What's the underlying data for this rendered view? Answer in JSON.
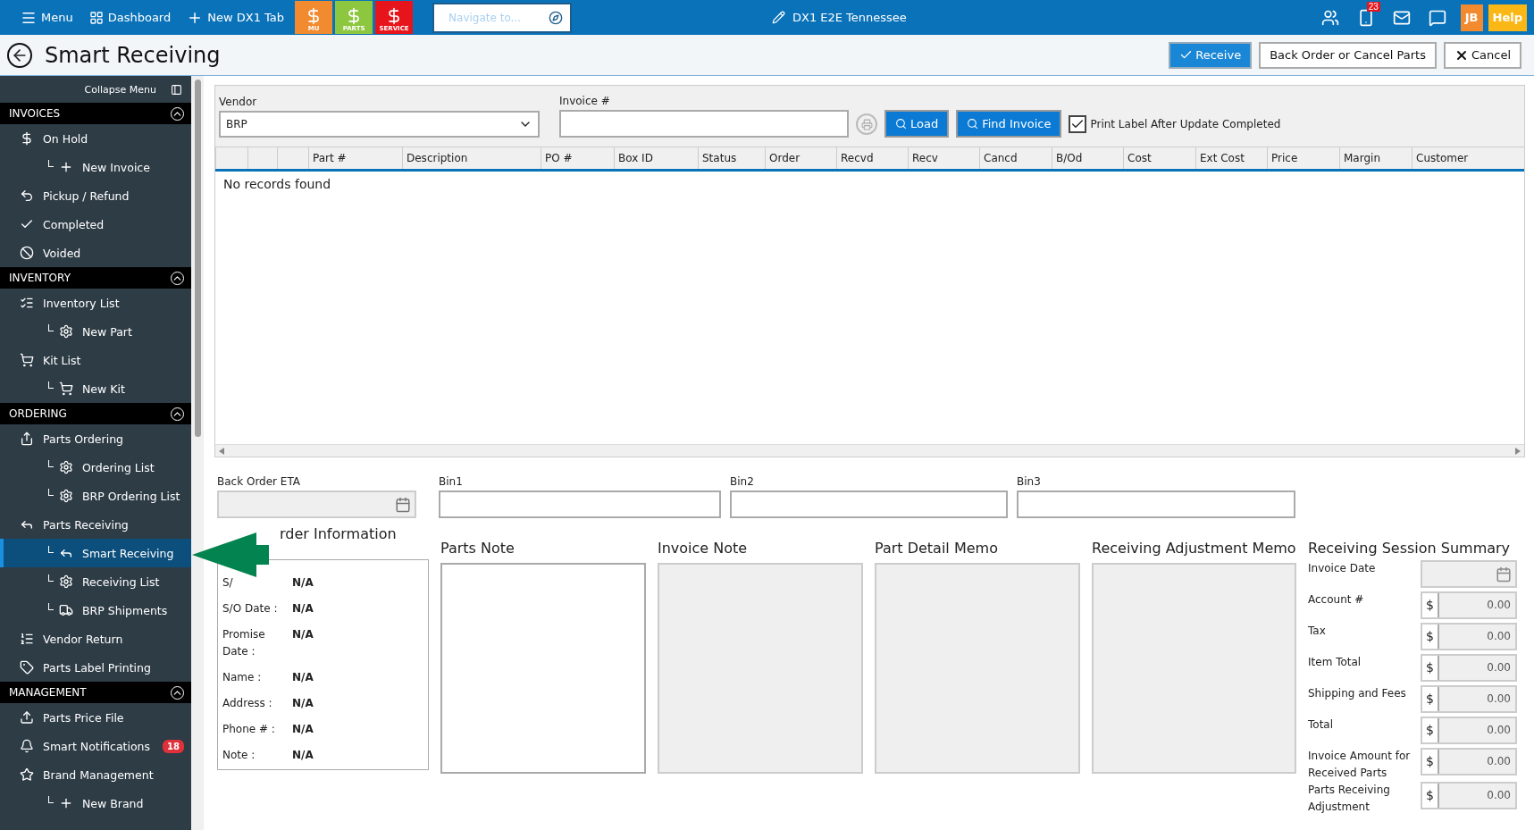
{
  "topbar": {
    "menu": "Menu",
    "dashboard": "Dashboard",
    "new_tab": "New DX1 Tab",
    "quick_buttons": [
      {
        "label": "MU",
        "color": "#f28a30"
      },
      {
        "label": "PARTS",
        "color": "#8dc63f"
      },
      {
        "label": "SERVICE",
        "color": "#e8141b"
      }
    ],
    "navigate": {
      "placeholder": "Navigate to..."
    },
    "location": "DX1 E2E Tennessee",
    "phone_badge": "23",
    "user": "JB",
    "help": "Help"
  },
  "page": {
    "title": "Smart Receiving",
    "buttons": [
      {
        "label": "Receive",
        "kind": "primary"
      },
      {
        "label": "Back Order or Cancel Parts",
        "kind": "plain"
      },
      {
        "label": "Cancel",
        "kind": "cancel"
      }
    ]
  },
  "sidebar": {
    "collapse": "Collapse Menu",
    "sections": [
      {
        "title": "INVOICES",
        "expanded": true,
        "items": [
          {
            "label": "On Hold",
            "selected": false,
            "children": [
              {
                "label": "New Invoice",
                "selected": false
              }
            ]
          },
          {
            "label": "Pickup / Refund",
            "selected": false
          },
          {
            "label": "Completed",
            "selected": false
          },
          {
            "label": "Voided",
            "selected": false
          }
        ]
      },
      {
        "title": "INVENTORY",
        "expanded": true,
        "items": [
          {
            "label": "Inventory List",
            "selected": false,
            "children": [
              {
                "label": "New Part",
                "selected": false
              }
            ]
          },
          {
            "label": "Kit List",
            "selected": false,
            "children": [
              {
                "label": "New Kit",
                "selected": false
              }
            ]
          }
        ]
      },
      {
        "title": "ORDERING",
        "expanded": true,
        "items": [
          {
            "label": "Parts Ordering",
            "selected": false,
            "children": [
              {
                "label": "Ordering List",
                "selected": false
              },
              {
                "label": "BRP Ordering List",
                "selected": false
              }
            ]
          },
          {
            "label": "Parts Receiving",
            "selected": false,
            "children": [
              {
                "label": "Smart Receiving",
                "selected": true
              },
              {
                "label": "Receiving List",
                "selected": false
              },
              {
                "label": "BRP Shipments",
                "selected": false
              }
            ]
          },
          {
            "label": "Vendor Return",
            "selected": false
          },
          {
            "label": "Parts Label Printing",
            "selected": false
          }
        ]
      },
      {
        "title": "MANAGEMENT",
        "expanded": true,
        "items": [
          {
            "label": "Parts Price File",
            "selected": false
          },
          {
            "label": "Smart Notifications",
            "selected": false,
            "badge": "18"
          },
          {
            "label": "Brand Management",
            "selected": false,
            "children": [
              {
                "label": "New Brand",
                "selected": false
              }
            ]
          }
        ]
      }
    ]
  },
  "form": {
    "vendor": {
      "label": "Vendor",
      "value": "BRP"
    },
    "invoice": {
      "label": "Invoice #"
    },
    "load": "Load",
    "find": "Find Invoice",
    "print_label": {
      "label": "Print Label After Update Completed",
      "checked": true
    }
  },
  "table": {
    "columns": [
      "",
      "",
      "",
      "Part #",
      "Description",
      "PO #",
      "Box ID",
      "Status",
      "Order",
      "Recvd",
      "Recv",
      "Cancd",
      "B/Od",
      "Cost",
      "Ext Cost",
      "Price",
      "Margin",
      "Customer"
    ],
    "empty": "No records found"
  },
  "bins": [
    {
      "label": "Back Order ETA",
      "kind": "date",
      "disabled": true
    },
    {
      "label": "Bin1",
      "kind": "text",
      "disabled": false
    },
    {
      "label": "Bin2",
      "kind": "text",
      "disabled": false
    },
    {
      "label": "Bin3",
      "kind": "text",
      "disabled": false
    }
  ],
  "sales_order": {
    "title": "rder Information",
    "rows": [
      {
        "label": "S/",
        "value": "N/A"
      },
      {
        "label": "S/O Date :",
        "value": "N/A"
      },
      {
        "label": "Promise Date :",
        "value": "N/A"
      },
      {
        "label": "Name :",
        "value": "N/A"
      },
      {
        "label": "Address :",
        "value": "N/A"
      },
      {
        "label": "Phone # :",
        "value": "N/A"
      },
      {
        "label": "Note :",
        "value": "N/A"
      }
    ]
  },
  "notes": [
    {
      "title": "Parts Note",
      "disabled": false
    },
    {
      "title": "Invoice Note",
      "disabled": true
    },
    {
      "title": "Part Detail Memo",
      "disabled": true
    },
    {
      "title": "Receiving Adjustment Memo",
      "disabled": true
    }
  ],
  "summary": {
    "title": "Receiving Session Summary",
    "rows": [
      {
        "label": "Invoice Date",
        "kind": "date"
      },
      {
        "label": "Account #",
        "kind": "money",
        "symbol": "$",
        "value": "0.00"
      },
      {
        "label": "Tax",
        "kind": "money",
        "symbol": "$",
        "value": "0.00"
      },
      {
        "label": "Item Total",
        "kind": "money",
        "symbol": "$",
        "value": "0.00"
      },
      {
        "label": "Shipping and Fees",
        "kind": "money",
        "symbol": "$",
        "value": "0.00"
      },
      {
        "label": "Total",
        "kind": "money",
        "symbol": "$",
        "value": "0.00"
      },
      {
        "label": "Invoice Amount for Received Parts",
        "kind": "money",
        "symbol": "$",
        "value": "0.00"
      },
      {
        "label": "Parts Receiving Adjustment",
        "kind": "money",
        "symbol": "$",
        "value": "0.00"
      }
    ]
  }
}
